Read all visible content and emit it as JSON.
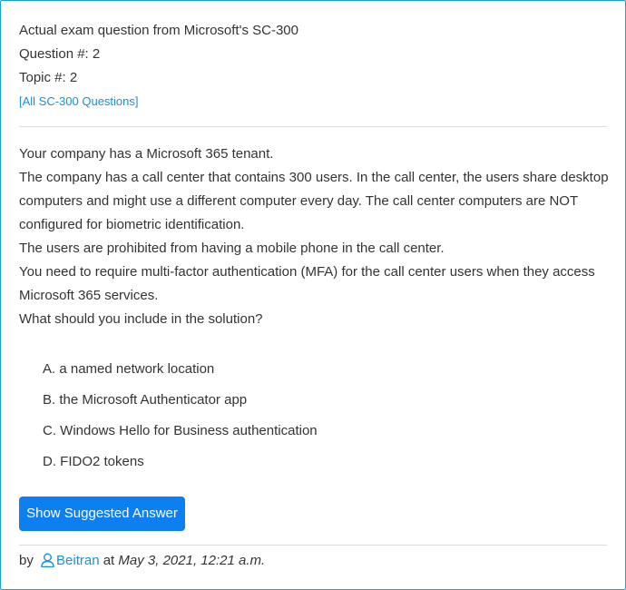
{
  "header": {
    "line1": "Actual exam question from Microsoft's SC-300",
    "line2": "Question #: 2",
    "line3": "Topic #: 2",
    "all_questions_link": "[All SC-300 Questions]"
  },
  "question": {
    "paragraphs": [
      "Your company has a Microsoft 365 tenant.",
      "The company has a call center that contains 300 users. In the call center, the users share desktop computers and might use a different computer every day. The call center computers are NOT configured for biometric identification.",
      "The users are prohibited from having a mobile phone in the call center.",
      "You need to require multi-factor authentication (MFA) for the call center users when they access Microsoft 365 services.",
      "What should you include in the solution?"
    ]
  },
  "choices": [
    "A. a named network location",
    "B. the Microsoft Authenticator app",
    "C. Windows Hello for Business authentication",
    "D. FIDO2 tokens"
  ],
  "show_answer_button": "Show Suggested Answer",
  "footer": {
    "by_label": "by",
    "user_icon": "user-icon",
    "username": "Beitran",
    "at_label": "at",
    "date": "May 3, 2021, 12:21 a.m."
  },
  "colors": {
    "border": "#1a9fd9",
    "link": "#1a8fd4",
    "button": "#0d7ff0"
  }
}
